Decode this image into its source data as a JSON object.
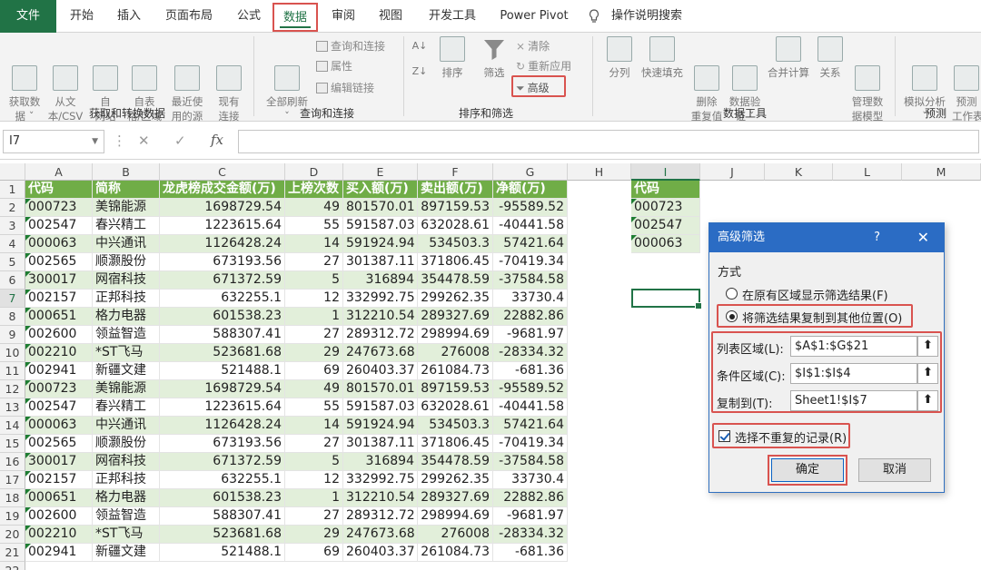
{
  "tabs": [
    {
      "label": "文件",
      "kind": "file"
    },
    {
      "label": "开始"
    },
    {
      "label": "插入"
    },
    {
      "label": "页面布局"
    },
    {
      "label": "公式"
    },
    {
      "label": "数据",
      "kind": "active"
    },
    {
      "label": "审阅"
    },
    {
      "label": "视图"
    },
    {
      "label": "开发工具"
    },
    {
      "label": "Power Pivot"
    },
    {
      "label": "操作说明搜索"
    }
  ],
  "ribbon": {
    "get_data": "获取数\n据 ˇ",
    "from_text": "从文\n本/CSV",
    "from_web": "自\n网站",
    "from_table": "自表\n格/区域",
    "recent_sources": "最近使\n用的源",
    "existing_conn": "现有\n连接",
    "refresh_all": "全部刷新\nˇ",
    "queries_conn": "查询和连接",
    "properties": "属性",
    "edit_links": "编辑链接",
    "sort": "排序",
    "filter": "筛选",
    "clear": "清除",
    "reapply": "重新应用",
    "advanced": "高级",
    "split": "分列",
    "flash_fill": "快速填充",
    "remove_dup": "删除\n重复值",
    "validation": "数据验\n证 ˇ",
    "consolidate": "合并计算",
    "relations": "关系",
    "data_model": "管理数\n据模型",
    "what_if": "模拟分析\nˇ",
    "forecast": "预测\n工作表",
    "group_get": "获取和转换数据",
    "group_query": "查询和连接",
    "group_sort": "排序和筛选",
    "group_tools": "数据工具",
    "group_forecast": "预测"
  },
  "formula_bar": {
    "name_box": "I7",
    "formula": ""
  },
  "columns": [
    "A",
    "B",
    "C",
    "D",
    "E",
    "F",
    "G",
    "H",
    "I",
    "J",
    "K",
    "L",
    "M"
  ],
  "rows": [
    "1",
    "2",
    "3",
    "4",
    "5",
    "6",
    "7",
    "8",
    "9",
    "10",
    "11",
    "12",
    "13",
    "14",
    "15",
    "16",
    "17",
    "18",
    "19",
    "20",
    "21",
    "22"
  ],
  "table": {
    "headers": [
      "代码",
      "简称",
      "龙虎榜成交金额(万)",
      "上榜次数",
      "买入额(万)",
      "卖出额(万)",
      "净额(万)"
    ],
    "rows": [
      [
        "000723",
        "美锦能源",
        "1698729.54",
        "49",
        "801570.01",
        "897159.53",
        "-95589.52"
      ],
      [
        "002547",
        "春兴精工",
        "1223615.64",
        "55",
        "591587.03",
        "632028.61",
        "-40441.58"
      ],
      [
        "000063",
        "中兴通讯",
        "1126428.24",
        "14",
        "591924.94",
        "534503.3",
        "57421.64"
      ],
      [
        "002565",
        "顺灏股份",
        "673193.56",
        "27",
        "301387.11",
        "371806.45",
        "-70419.34"
      ],
      [
        "300017",
        "网宿科技",
        "671372.59",
        "5",
        "316894",
        "354478.59",
        "-37584.58"
      ],
      [
        "002157",
        "正邦科技",
        "632255.1",
        "12",
        "332992.75",
        "299262.35",
        "33730.4"
      ],
      [
        "000651",
        "格力电器",
        "601538.23",
        "1",
        "312210.54",
        "289327.69",
        "22882.86"
      ],
      [
        "002600",
        "领益智造",
        "588307.41",
        "27",
        "289312.72",
        "298994.69",
        "-9681.97"
      ],
      [
        "002210",
        "*ST飞马",
        "523681.68",
        "29",
        "247673.68",
        "276008",
        "-28334.32"
      ],
      [
        "002941",
        "新疆文建",
        "521488.1",
        "69",
        "260403.37",
        "261084.73",
        "-681.36"
      ],
      [
        "000723",
        "美锦能源",
        "1698729.54",
        "49",
        "801570.01",
        "897159.53",
        "-95589.52"
      ],
      [
        "002547",
        "春兴精工",
        "1223615.64",
        "55",
        "591587.03",
        "632028.61",
        "-40441.58"
      ],
      [
        "000063",
        "中兴通讯",
        "1126428.24",
        "14",
        "591924.94",
        "534503.3",
        "57421.64"
      ],
      [
        "002565",
        "顺灏股份",
        "673193.56",
        "27",
        "301387.11",
        "371806.45",
        "-70419.34"
      ],
      [
        "300017",
        "网宿科技",
        "671372.59",
        "5",
        "316894",
        "354478.59",
        "-37584.58"
      ],
      [
        "002157",
        "正邦科技",
        "632255.1",
        "12",
        "332992.75",
        "299262.35",
        "33730.4"
      ],
      [
        "000651",
        "格力电器",
        "601538.23",
        "1",
        "312210.54",
        "289327.69",
        "22882.86"
      ],
      [
        "002600",
        "领益智造",
        "588307.41",
        "27",
        "289312.72",
        "298994.69",
        "-9681.97"
      ],
      [
        "002210",
        "*ST飞马",
        "523681.68",
        "29",
        "247673.68",
        "276008",
        "-28334.32"
      ],
      [
        "002941",
        "新疆文建",
        "521488.1",
        "69",
        "260403.37",
        "261084.73",
        "-681.36"
      ]
    ]
  },
  "criteria": {
    "header": "代码",
    "values": [
      "000723",
      "002547",
      "000063"
    ]
  },
  "dialog": {
    "title": "高级筛选",
    "help": "?",
    "close": "✕",
    "mode_label": "方式",
    "option_in_place": "在原有区域显示筛选结果(F)",
    "option_copy": "将筛选结果复制到其他位置(O)",
    "list_range_label": "列表区域(L):",
    "list_range_value": "$A$1:$G$21",
    "criteria_range_label": "条件区域(C):",
    "criteria_range_value": "$I$1:$I$4",
    "copy_to_label": "复制到(T):",
    "copy_to_value": "Sheet1!$I$7",
    "unique_label": "选择不重复的记录(R)",
    "ok": "确定",
    "cancel": "取消"
  },
  "colors": {
    "accent": "#217346",
    "header_green": "#70ad47",
    "band_green": "#e2efda",
    "highlight_red": "#d9534f",
    "dialog_blue": "#2b6cc4"
  }
}
